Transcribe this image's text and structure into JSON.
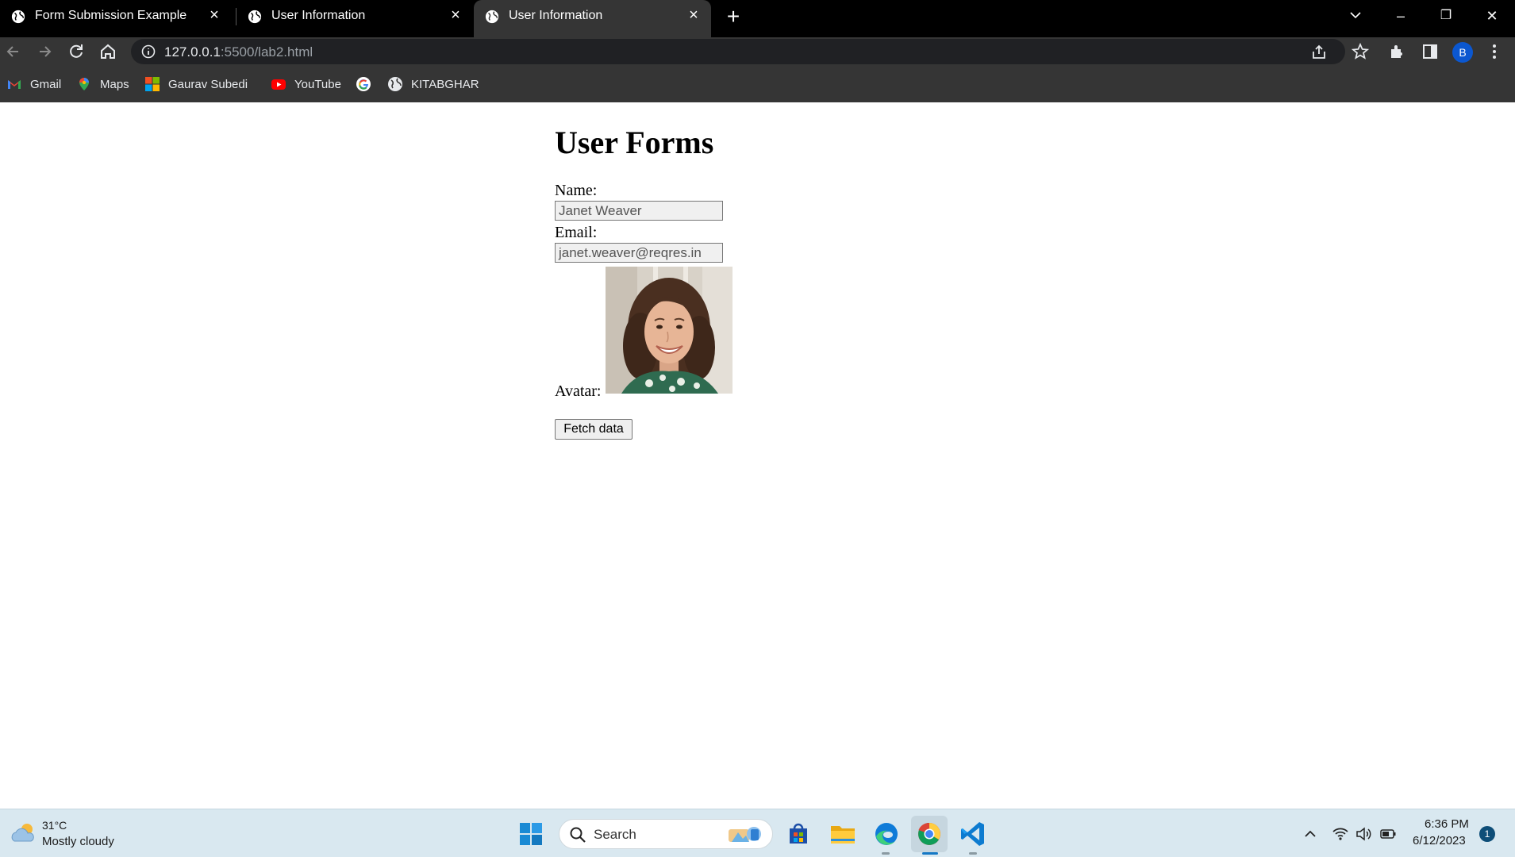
{
  "browser": {
    "tabs": [
      {
        "title": "Form Submission Example",
        "active": false
      },
      {
        "title": "User Information",
        "active": false
      },
      {
        "title": "User Information",
        "active": true
      }
    ],
    "new_tab_label": "+",
    "window_controls": {
      "minimize": "–",
      "restore": "❐",
      "close": "✕"
    },
    "url": {
      "host": "127.0.0.1",
      "rest": ":5500/lab2.html"
    },
    "profile_initial": "B",
    "bookmarks": [
      {
        "label": "Gmail",
        "icon": "gmail-icon"
      },
      {
        "label": "Maps",
        "icon": "maps-icon"
      },
      {
        "label": "Gaurav Subedi",
        "icon": "microsoft-icon"
      },
      {
        "label": "YouTube",
        "icon": "youtube-icon"
      },
      {
        "label": "",
        "icon": "google-icon"
      },
      {
        "label": "KITABGHAR",
        "icon": "globe-icon"
      }
    ]
  },
  "page": {
    "heading": "User Forms",
    "name_label": "Name:",
    "name_value": "Janet Weaver",
    "email_label": "Email:",
    "email_value": "janet.weaver@reqres.in",
    "avatar_label": "Avatar:",
    "fetch_button": "Fetch data"
  },
  "taskbar": {
    "weather_temp": "31°C",
    "weather_desc": "Mostly cloudy",
    "search_placeholder": "Search",
    "apps": [
      "store-icon",
      "file-explorer-icon",
      "edge-icon",
      "chrome-icon",
      "vscode-icon"
    ],
    "time": "6:36 PM",
    "date": "6/12/2023",
    "notification_count": "1"
  },
  "colors": {
    "tabstrip": "#000000",
    "toolbar": "#353535",
    "omnibox": "#202124",
    "taskbar": "#d9e8f0",
    "profile": "#0b57d0"
  }
}
